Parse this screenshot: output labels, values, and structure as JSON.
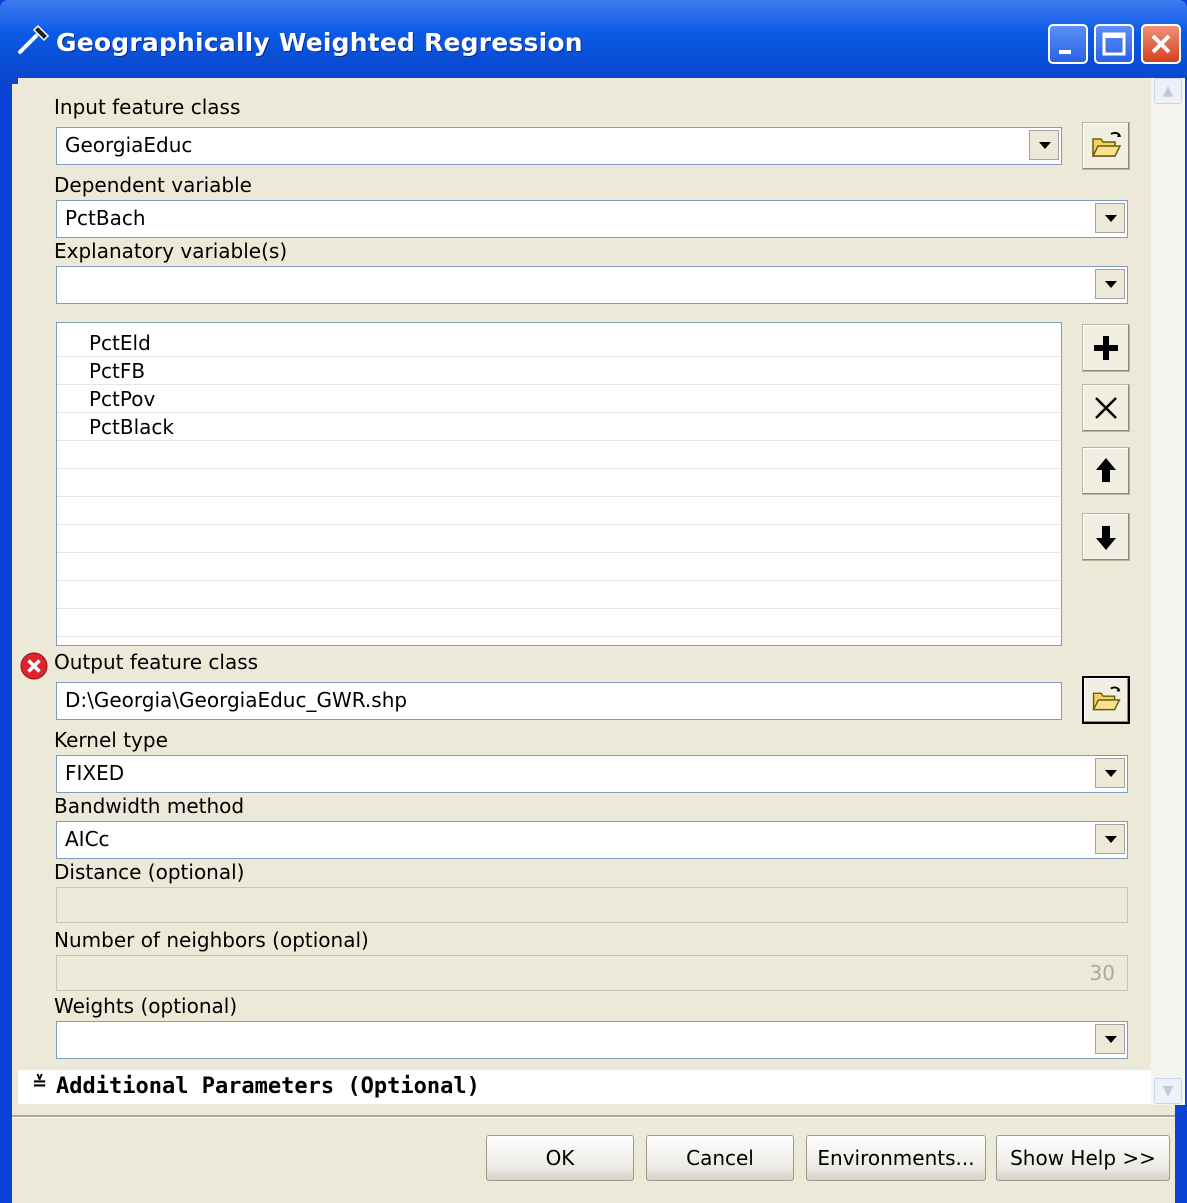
{
  "window": {
    "title": "Geographically Weighted Regression",
    "title_icon": "hammer-icon"
  },
  "form": {
    "input_feature_class": {
      "label": "Input feature class",
      "value": "GeorgiaEduc"
    },
    "dependent_variable": {
      "label": "Dependent variable",
      "value": "PctBach"
    },
    "explanatory_variables": {
      "label": "Explanatory variable(s)",
      "value": "",
      "items": [
        "PctEld",
        "PctFB",
        "PctPov",
        "PctBlack"
      ]
    },
    "output_feature_class": {
      "label": "Output feature class",
      "value": "D:\\Georgia\\GeorgiaEduc_GWR.shp",
      "status": "error-icon"
    },
    "kernel_type": {
      "label": "Kernel type",
      "value": "FIXED"
    },
    "bandwidth_method": {
      "label": "Bandwidth method",
      "value": "AICc"
    },
    "distance": {
      "label": "Distance (optional)",
      "value": ""
    },
    "number_of_neighbors": {
      "label": "Number of neighbors (optional)",
      "value": "30"
    },
    "weights": {
      "label": "Weights (optional)",
      "value": ""
    },
    "additional_parameters": {
      "label": "Additional Parameters (Optional)",
      "icon": "double-chevron-down-icon"
    }
  },
  "buttons": {
    "ok": "OK",
    "cancel": "Cancel",
    "environments": "Environments...",
    "show_help": "Show Help >>"
  },
  "colors": {
    "titlebar": "#0a4ed6",
    "dialog_bg": "#ece9d8",
    "close_button": "#d6401e"
  }
}
